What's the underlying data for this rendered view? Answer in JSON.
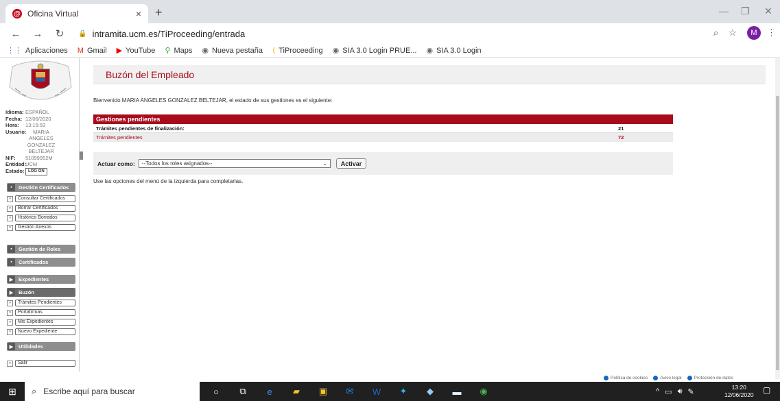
{
  "browser": {
    "tab_title": "Oficina Virtual",
    "tab_icon": "@",
    "url": "intramita.ucm.es/TiProceeding/entrada",
    "profile_initial": "M",
    "bookmarks": [
      {
        "label": "Aplicaciones",
        "icon": "apps-icon"
      },
      {
        "label": "Gmail",
        "icon": "gmail-icon"
      },
      {
        "label": "YouTube",
        "icon": "youtube-icon"
      },
      {
        "label": "Maps",
        "icon": "maps-icon"
      },
      {
        "label": "Nueva pestaña",
        "icon": "globe-icon"
      },
      {
        "label": "TiProceeding",
        "icon": "tiproceeding-icon"
      },
      {
        "label": "SIA 3.0 Login PRUE...",
        "icon": "globe-icon"
      },
      {
        "label": "SIA 3.0 Login",
        "icon": "globe-icon"
      }
    ]
  },
  "sidebar": {
    "info": [
      {
        "key": "Idioma:",
        "value": "ESPAÑOL"
      },
      {
        "key": "Fecha:",
        "value": "12/06/2020"
      },
      {
        "key": "Hora:",
        "value": "13:15:53"
      },
      {
        "key": "Usuario:",
        "value": "MARIA ANGELES GONZALEZ BELTEJAR"
      },
      {
        "key": "NIF:",
        "value": "51099952M"
      },
      {
        "key": "Entidad:",
        "value": "UCM"
      },
      {
        "key": "Estado:",
        "value": "LOG ON"
      }
    ],
    "sections": [
      {
        "label": "Gestión Certificados",
        "items": [
          "Consultar Certificados",
          "Borrar Certificados",
          "Histórico Borrados",
          "Gestión Anexos"
        ]
      },
      {
        "label": "Gestión de Roles",
        "items": []
      },
      {
        "label": "Certificados",
        "items": []
      },
      {
        "label": "Expedientes",
        "items": []
      },
      {
        "label": "Buzón",
        "items": [
          "Trámites Pendientes",
          "Portafirmas",
          "Mis Expedientes",
          "Nuevo Expediente"
        ]
      },
      {
        "label": "Utilidades",
        "items": [
          "Salir"
        ]
      }
    ]
  },
  "main": {
    "title": "Buzón del Empleado",
    "welcome": "Bienvenido MARIA ANGELES GONZALEZ BELTEJAR, el estado de sus gestiones es el siguiente:",
    "pending_header": "Gestiones pendientes",
    "pending_rows": [
      {
        "label": "Trámites pendientes de finalización:",
        "value": "21"
      },
      {
        "label": "Trámites pendientes",
        "value": "72"
      }
    ],
    "actuar_label": "Actuar como:",
    "actuar_select": "--Todos los roles asignados--",
    "actuar_button": "Activar",
    "hint": "Use las opciones del menú de la izquierda para completarlas."
  },
  "footer": {
    "links": [
      "Política de cookies",
      "Aviso legal",
      "Protección de datos"
    ]
  },
  "taskbar": {
    "search_placeholder": "Escribe aquí para buscar",
    "time": "13:20",
    "date": "12/06/2020"
  },
  "colors": {
    "accent": "#a80c1c",
    "sidebar_section": "#8e8e8e"
  }
}
